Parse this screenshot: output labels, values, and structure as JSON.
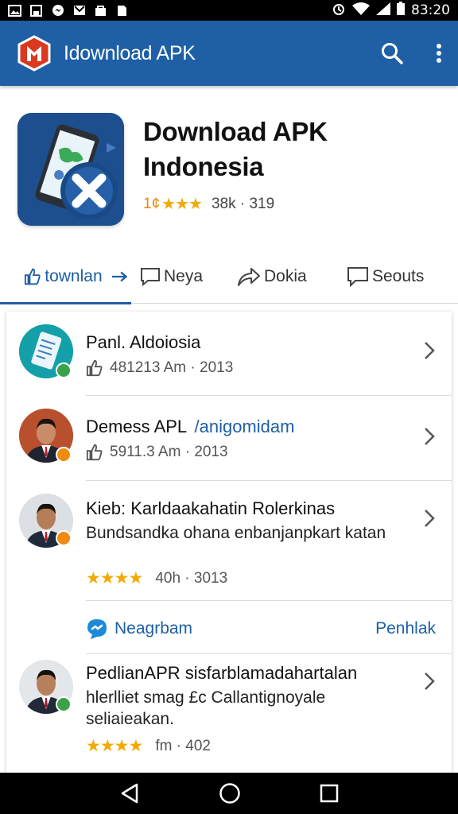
{
  "status_bar": {
    "left_icons": [
      "image-icon",
      "portrait-icon",
      "messenger-icon",
      "gmail-icon",
      "bag-icon",
      "document-icon"
    ],
    "right_icons": [
      "alarm-icon",
      "wifi-icon",
      "signal-icon",
      "battery-icon"
    ],
    "time": "83:20"
  },
  "app_bar": {
    "title": "Idownload APK",
    "brand_color": "#1e5fa6"
  },
  "app": {
    "name_line1": "Download APK",
    "name_line2": "Indonesia",
    "rating_prefix": "1¢",
    "stars": "★★★",
    "downloads": "38k · 319"
  },
  "tabs": [
    {
      "label": "townlan",
      "icon": "thumbs-up-icon",
      "active": true
    },
    {
      "label": "Neya",
      "icon": "comment-icon"
    },
    {
      "label": "Dokia",
      "icon": "share-icon"
    },
    {
      "label": "Seouts",
      "icon": "chat-icon"
    }
  ],
  "list": {
    "items": [
      {
        "title": "Panl. Aldoiosia",
        "meta": "481213 Am · 2013"
      },
      {
        "title": "Demess APL",
        "title_link": "/anigomidam",
        "meta": "5911.3 Am · 2013"
      },
      {
        "title": "Kieb: Karldaakahatin Rolerkinas",
        "desc": "Bundsandka ohana enbanjanpkart katan",
        "stars": "★★★★",
        "meta": "40h · 3013"
      },
      {
        "title": "PedlianAPR sisfarblamadahartalan",
        "desc": "hlerlliet smag £c Callantignoyale seliaieakan.",
        "stars": "★★★★",
        "meta": "fm · 402"
      }
    ],
    "section": {
      "label": "Neagrbam",
      "link": "Penhlak"
    }
  }
}
